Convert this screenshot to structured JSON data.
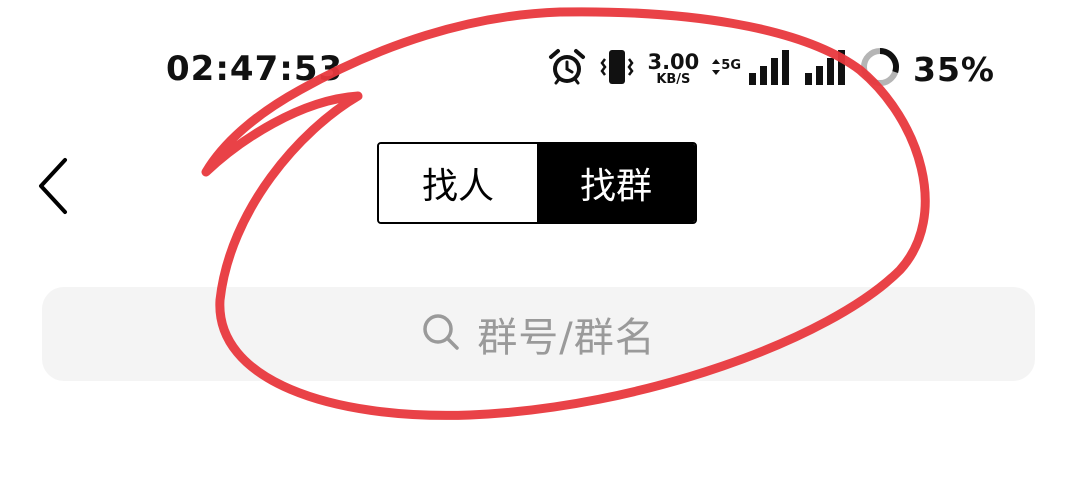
{
  "status_bar": {
    "time": "02:47:53",
    "speed_value": "3.00",
    "speed_unit": "KB/S",
    "network_type": "5G",
    "battery_percent": "35%",
    "icons": [
      "alarm-icon",
      "vibrate-icon",
      "data-arrows-icon",
      "signal-icon",
      "signal-icon-2",
      "battery-ring-icon"
    ]
  },
  "header": {
    "back_icon": "chevron-left-icon",
    "tabs": [
      {
        "label": "找人",
        "active": false
      },
      {
        "label": "找群",
        "active": true
      }
    ]
  },
  "search": {
    "placeholder": "群号/群名",
    "icon": "search-icon"
  },
  "annotation": {
    "color": "#e8383d"
  }
}
